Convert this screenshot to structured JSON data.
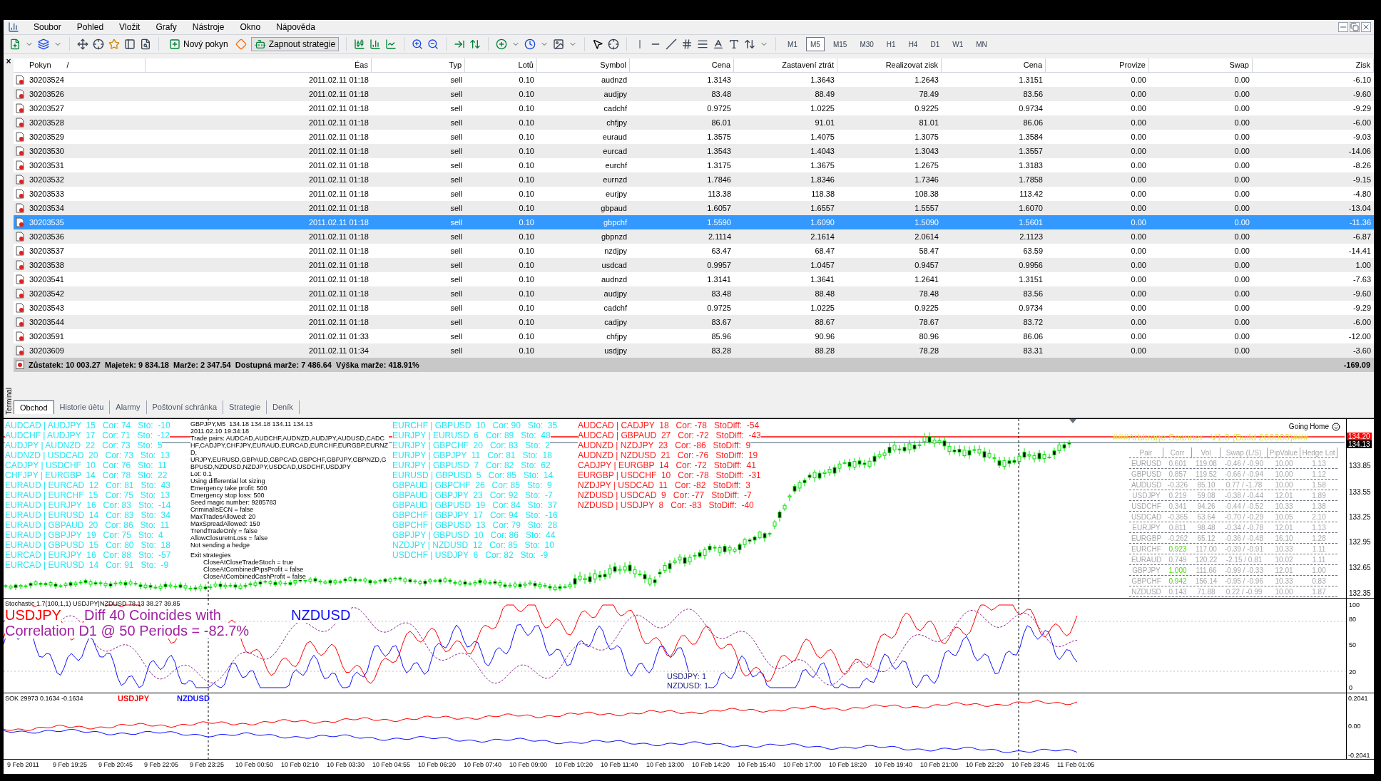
{
  "menu": [
    "Soubor",
    "Pohled",
    "Vložit",
    "Grafy",
    "Nástroje",
    "Okno",
    "Nápověda"
  ],
  "toolbar": {
    "new_order": "Nový pokyn",
    "strategies": "Zapnout strategie",
    "timeframes": [
      {
        "label": "M1",
        "selected": false
      },
      {
        "label": "M5",
        "selected": true
      },
      {
        "label": "M15",
        "selected": false
      },
      {
        "label": "M30",
        "selected": false
      },
      {
        "label": "H1",
        "selected": false
      },
      {
        "label": "H4",
        "selected": false
      },
      {
        "label": "D1",
        "selected": false
      },
      {
        "label": "W1",
        "selected": false
      },
      {
        "label": "MN",
        "selected": false
      }
    ]
  },
  "terminal": {
    "close": "×",
    "side_label": "Terminal",
    "sort_mark": "/",
    "columns": [
      "Pokyn",
      "Éas",
      "Typ",
      "Lotů",
      "Symbol",
      "Cena",
      "Zastavení ztrát",
      "Realizovat zisk",
      "Cena",
      "Provize",
      "Swap",
      "Zisk"
    ],
    "rows": [
      {
        "selected": false,
        "cells": [
          "30203524",
          "2011.02.11 01:18",
          "sell",
          "0.10",
          "audnzd",
          "1.3143",
          "1.3643",
          "1.2643",
          "1.3151",
          "0.00",
          "0.00",
          "-6.10"
        ]
      },
      {
        "selected": false,
        "cells": [
          "30203526",
          "2011.02.11 01:18",
          "sell",
          "0.10",
          "audjpy",
          "83.48",
          "88.49",
          "78.49",
          "83.56",
          "0.00",
          "0.00",
          "-9.60"
        ]
      },
      {
        "selected": false,
        "cells": [
          "30203527",
          "2011.02.11 01:18",
          "sell",
          "0.10",
          "cadchf",
          "0.9725",
          "1.0225",
          "0.9225",
          "0.9734",
          "0.00",
          "0.00",
          "-9.29"
        ]
      },
      {
        "selected": false,
        "cells": [
          "30203528",
          "2011.02.11 01:18",
          "sell",
          "0.10",
          "chfjpy",
          "86.01",
          "91.01",
          "81.01",
          "86.06",
          "0.00",
          "0.00",
          "-6.00"
        ]
      },
      {
        "selected": false,
        "cells": [
          "30203529",
          "2011.02.11 01:18",
          "sell",
          "0.10",
          "euraud",
          "1.3575",
          "1.4075",
          "1.3075",
          "1.3584",
          "0.00",
          "0.00",
          "-9.03"
        ]
      },
      {
        "selected": false,
        "cells": [
          "30203530",
          "2011.02.11 01:18",
          "sell",
          "0.10",
          "eurcad",
          "1.3543",
          "1.4043",
          "1.3043",
          "1.3557",
          "0.00",
          "0.00",
          "-14.06"
        ]
      },
      {
        "selected": false,
        "cells": [
          "30203531",
          "2011.02.11 01:18",
          "sell",
          "0.10",
          "eurchf",
          "1.3175",
          "1.3675",
          "1.2675",
          "1.3183",
          "0.00",
          "0.00",
          "-8.26"
        ]
      },
      {
        "selected": false,
        "cells": [
          "30203532",
          "2011.02.11 01:18",
          "sell",
          "0.10",
          "eurnzd",
          "1.7846",
          "1.8346",
          "1.7346",
          "1.7858",
          "0.00",
          "0.00",
          "-9.15"
        ]
      },
      {
        "selected": false,
        "cells": [
          "30203533",
          "2011.02.11 01:18",
          "sell",
          "0.10",
          "eurjpy",
          "113.38",
          "118.38",
          "108.38",
          "113.42",
          "0.00",
          "0.00",
          "-4.80"
        ]
      },
      {
        "selected": false,
        "cells": [
          "30203534",
          "2011.02.11 01:18",
          "sell",
          "0.10",
          "gbpaud",
          "1.6057",
          "1.6557",
          "1.5557",
          "1.6070",
          "0.00",
          "0.00",
          "-13.04"
        ]
      },
      {
        "selected": true,
        "cells": [
          "30203535",
          "2011.02.11 01:18",
          "sell",
          "0.10",
          "gbpchf",
          "1.5590",
          "1.6090",
          "1.5090",
          "1.5601",
          "0.00",
          "0.00",
          "-11.36"
        ]
      },
      {
        "selected": false,
        "cells": [
          "30203536",
          "2011.02.11 01:18",
          "sell",
          "0.10",
          "gbpnzd",
          "2.1114",
          "2.1614",
          "2.0614",
          "2.1123",
          "0.00",
          "0.00",
          "-6.87"
        ]
      },
      {
        "selected": false,
        "cells": [
          "30203537",
          "2011.02.11 01:18",
          "sell",
          "0.10",
          "nzdjpy",
          "63.47",
          "68.47",
          "58.47",
          "63.59",
          "0.00",
          "0.00",
          "-14.41"
        ]
      },
      {
        "selected": false,
        "cells": [
          "30203538",
          "2011.02.11 01:18",
          "sell",
          "0.10",
          "usdcad",
          "0.9957",
          "1.0457",
          "0.9457",
          "0.9956",
          "0.00",
          "0.00",
          "1.00"
        ]
      },
      {
        "selected": false,
        "cells": [
          "30203541",
          "2011.02.11 01:18",
          "sell",
          "0.10",
          "audnzd",
          "1.3141",
          "1.3641",
          "1.2641",
          "1.3151",
          "0.00",
          "0.00",
          "-7.63"
        ]
      },
      {
        "selected": false,
        "cells": [
          "30203542",
          "2011.02.11 01:18",
          "sell",
          "0.10",
          "audjpy",
          "83.48",
          "88.48",
          "78.48",
          "83.56",
          "0.00",
          "0.00",
          "-9.60"
        ]
      },
      {
        "selected": false,
        "cells": [
          "30203543",
          "2011.02.11 01:18",
          "sell",
          "0.10",
          "cadchf",
          "0.9725",
          "1.0225",
          "0.9225",
          "0.9734",
          "0.00",
          "0.00",
          "-9.29"
        ]
      },
      {
        "selected": false,
        "cells": [
          "30203544",
          "2011.02.11 01:18",
          "sell",
          "0.10",
          "cadjpy",
          "83.67",
          "88.67",
          "78.67",
          "83.72",
          "0.00",
          "0.00",
          "-6.00"
        ]
      },
      {
        "selected": false,
        "cells": [
          "30203591",
          "2011.02.11 01:33",
          "sell",
          "0.10",
          "chfjpy",
          "85.96",
          "90.96",
          "80.96",
          "86.06",
          "0.00",
          "0.00",
          "-12.00"
        ]
      },
      {
        "selected": false,
        "cells": [
          "30203609",
          "2011.02.11 01:34",
          "sell",
          "0.10",
          "usdjpy",
          "83.28",
          "88.28",
          "78.28",
          "83.31",
          "0.00",
          "0.00",
          "-3.60"
        ]
      }
    ],
    "summary": "Zůstatek: 10 003.27  Majetek: 9 834.18  Marže: 2 347.54  Dostupná marže: 7 486.64  Výška marže: 418.91%",
    "summary_total": "-169.09",
    "tabs": [
      {
        "label": "Obchod",
        "selected": true
      },
      {
        "label": "Historie úètu",
        "selected": false
      },
      {
        "label": "Alarmy",
        "selected": false
      },
      {
        "label": "Poštovní schránka",
        "selected": false
      },
      {
        "label": "Strategie",
        "selected": false
      },
      {
        "label": "Deník",
        "selected": false
      }
    ]
  },
  "chart": {
    "header": "GBPJPY,M5  134.18 134.18 134.11 134.13",
    "pairs_1": [
      "AUDCAD | AUDJPY  15   Cor: 74   Sto:  -10",
      "AUDCHF | AUDJPY  17   Cor: 71   Sto:  -12",
      "AUDJPY | AUDNZD  22   Cor: 73   Sto:  5",
      "AUDNZD | USDCAD  20   Cor: 73   Sto:  13",
      "CADJPY | USDCHF  10   Cor: 76   Sto:  11",
      "CHFJPY | EURGBP  14   Cor: 78   Sto:  22",
      "EURAUD | EURCAD  12   Cor: 81   Sto:  43",
      "EURAUD | EURCHF  15   Cor: 75   Sto:  13",
      "EURAUD | EURJPY  16   Cor: 83   Sto:  -14",
      "EURAUD | EURUSD  14   Cor: 83   Sto:  34",
      "EURAUD | GBPAUD  20   Cor: 86   Sto:  11",
      "EURAUD | GBPJPY  19   Cor: 75   Sto:  4",
      "EURAUD | GBPUSD  15   Cor: 80   Sto:  18",
      "EURCAD | EURJPY  16   Cor: 88   Sto:  -57",
      "EURCAD | EURUSD  14   Cor: 91   Sto:  -9"
    ],
    "pairs_2": [
      "EURCHF | GBPUSD  10   Cor: 90   Sto:  35",
      "EURJPY | EURUSD  6   Cor: 89   Sto:  48",
      "EURJPY | GBPCHF  20   Cor: 83   Sto:  2",
      "EURJPY | GBPJPY  11   Cor: 81   Sto:  18",
      "EURJPY | GBPUSD  7   Cor: 82   Sto:  62",
      "EURUSD | GBPUSD  5   Cor: 85   Sto:  14",
      "GBPAUD | GBPCHF  26   Cor: 85   Sto:  9",
      "GBPAUD | GBPJPY  23   Cor: 92   Sto:  -7",
      "GBPAUD | GBPUSD  19   Cor: 84   Sto:  37",
      "GBPCHF | GBPJPY  17   Cor: 94   Sto:  -16",
      "GBPCHF | GBPUSD  13   Cor: 79   Sto:  28",
      "GBPJPY | GBPUSD  10   Cor: 86   Sto:  44",
      "NZDJPY | NZDUSD  12   Cor: 85   Sto:  10",
      "USDCHF | USDJPY  6   Cor: 82   Sto:  -9"
    ],
    "pairs_neg": [
      "AUDCAD | CADJPY  18   Cor: -78   StoDiff:  -54",
      "AUDCAD | GBPAUD  27   Cor: -72   StoDiff:  -43",
      "AUDNZD | NZDJPY  23   Cor: -86   StoDiff:  9",
      "AUDNZD | NZDUSD  21   Cor: -76   StoDiff:  19",
      "CADJPY | EURGBP  14   Cor: -72   StoDiff:  41",
      "EURGBP | USDCHF  10   Cor: -78   StoDiff:  -31",
      "NZDJPY | USDCAD  11   Cor: -82   StoDiff:  3",
      "NZDUSD | USDCAD  9   Cor: -77   StoDiff:  -7",
      "NZDUSD | USDJPY  8   Cor: -83   StoDiff:  -40"
    ],
    "time": "2011.02.10 19:34:18",
    "trade_pairs": "Trade pairs: AUDCAD,AUDCHF,AUDNZD,AUDJPY,AUDUSD,CADCHF,CADJPY,CHFJPY,EURAUD,EURCAD,EURCHF,EURGBP,EURNZD,",
    "trade_pairs_2": "URJPY,EURUSD,GBPAUD,GBPCAD,GBPCHF,GBPJPY,GBPNZD,GBPUSD,NZDUSD,NZDJPY,USDCAD,USDCHF,USDJPY",
    "settings": [
      "Lot: 0.1",
      "Using differential lot sizing",
      "Emergency take profit: 500",
      "Emergency stop loss: 500",
      "Seed magic number: 9285783",
      "CriminalIsECN = false",
      "MaxTradesAllowed: 20",
      "MaxSpreadAllowed: 150",
      "TrendTradeOnly = false",
      "AllowClosureInLoss = false",
      "Not sending a hedge"
    ],
    "exit_title": "Exit strategies",
    "exit_lines": [
      "CloseAtCloseTradeStoch = true",
      "CloseAtCombinedPipsProfit = false",
      "CloseAtCombinedCashProfit = false"
    ],
    "going_home": "Going Home",
    "scanner_title": "###Arbitrage Scanner   V1.0 (Build 200000)###",
    "scanner": {
      "columns": [
        "Pair",
        "Corr",
        "Vol",
        "Swap (L/S)",
        "PipValue",
        "Hedge Lot"
      ],
      "rows": [
        {
          "highlight": false,
          "cells": [
            "EURUSD",
            "0.601",
            "119.08",
            "-0.46 / -0.90",
            "10.00",
            "1.13"
          ]
        },
        {
          "highlight": false,
          "cells": [
            "GBPUSD",
            "0.857",
            "119.52",
            "-0.66 / -0.94",
            "10.00",
            "1.12"
          ]
        },
        {
          "highlight": false,
          "cells": [
            "AUDUSD",
            "-0.326",
            "85.10",
            "0.77 / -1.78",
            "10.00",
            "1.58"
          ]
        },
        {
          "highlight": false,
          "cells": [
            "USDJPY",
            "0.219",
            "59.08",
            "-0.38 / -0.44",
            "12.01",
            "1.89"
          ]
        },
        {
          "highlight": false,
          "cells": [
            "USDCHF",
            "0.341",
            "94.26",
            "-0.44 / -0.52",
            "10.33",
            "1.38"
          ]
        },
        {
          "highlight": false,
          "cells": [
            "USDCAD",
            "-0.365",
            "63.64",
            "-0.70 / -0.29",
            "10.05",
            "2.10"
          ]
        },
        {
          "highlight": false,
          "cells": [
            "EURJPY",
            "0.811",
            "98.48",
            "-0.34 / -0.78",
            "12.01",
            "1.13"
          ]
        },
        {
          "highlight": false,
          "cells": [
            "EURGBP",
            "-0.262",
            "65.12",
            "-0.36 / -0.48",
            "16.10",
            "1.28"
          ]
        },
        {
          "highlight": true,
          "cells": [
            "EURCHF",
            "0.923",
            "117.00",
            "-0.39 / -0.91",
            "10.33",
            "1.11"
          ]
        },
        {
          "highlight": false,
          "cells": [
            "EURAUD",
            "0.749",
            "120.22",
            "-2.15 / 0.81",
            "10.02",
            "1.11"
          ]
        },
        {
          "highlight": true,
          "cells": [
            "GBPJPY",
            "1.000",
            "111.66",
            "-0.99 / -0.33",
            "12.01",
            "1.00"
          ]
        },
        {
          "highlight": true,
          "cells": [
            "GBPCHF",
            "0.942",
            "156.14",
            "-0.95 / -0.96",
            "10.33",
            "0.83"
          ]
        },
        {
          "highlight": false,
          "cells": [
            "NZDUSD",
            "0.143",
            "71.88",
            "0.22 / -0.99",
            "10.00",
            "1.87"
          ]
        }
      ]
    },
    "price_axis": [
      "133.85",
      "133.55",
      "133.25",
      "132.95",
      "132.65",
      "132.35"
    ],
    "ask_price": "134.20",
    "bid_price": "134.13"
  },
  "stochastic": {
    "header": "Stochastic 1.7(100,1,1) USDJPY|NZDUSD 78.13 38.27 39.85",
    "symbol_1": "USDJPY",
    "diff": "Diff 40 Coincides with",
    "correlation": "Correlation D1 @ 50 Periods = -82.7%",
    "symbol_2": "NZDUSD",
    "readings": [
      "USDJPY: 1",
      "NZDUSD: 1"
    ],
    "axis": [
      "100",
      "80",
      "50",
      "20",
      "0"
    ]
  },
  "sok": {
    "header": "SOK 29973 0.1634 -0.1634",
    "symbol_1": "USDJPY",
    "symbol_2": "NZDUSD",
    "axis": [
      "0.2041",
      "0.00",
      "-0.2041"
    ]
  },
  "time_axis": [
    "9 Feb 2011",
    "9 Feb 19:25",
    "9 Feb 20:45",
    "9 Feb 22:05",
    "9 Feb 23:25",
    "10 Feb 00:50",
    "10 Feb 02:10",
    "10 Feb 03:30",
    "10 Feb 04:55",
    "10 Feb 06:20",
    "10 Feb 07:40",
    "10 Feb 09:00",
    "10 Feb 10:20",
    "10 Feb 11:40",
    "10 Feb 13:00",
    "10 Feb 14:20",
    "10 Feb 15:40",
    "10 Feb 17:00",
    "10 Feb 18:20",
    "10 Feb 19:40",
    "10 Feb 21:00",
    "10 Feb 22:20",
    "10 Feb 23:45",
    "11 Feb 01:05"
  ]
}
